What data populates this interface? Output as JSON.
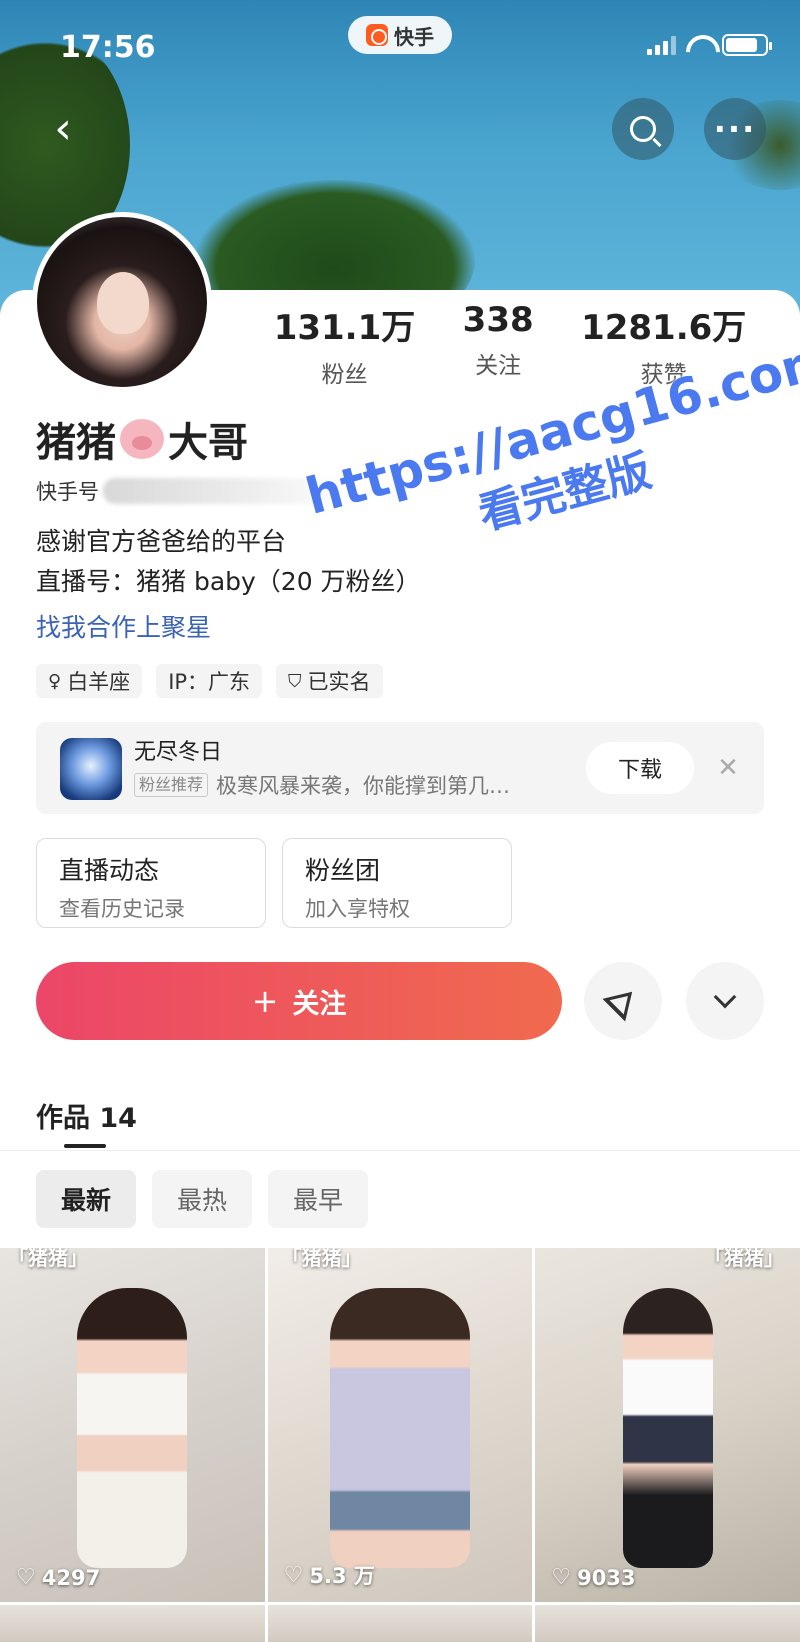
{
  "status_bar": {
    "time": "17:56",
    "app_name": "快手"
  },
  "profile": {
    "name_prefix": "猪猪",
    "name_suffix": "大哥",
    "kuaishou_id_label": "快手号",
    "bio_line1": "感谢官方爸爸给的平台",
    "bio_line2": "直播号：猪猪 baby（20 万粉丝）",
    "cooperation_link": "找我合作上聚星",
    "stats": [
      {
        "value": "131.1万",
        "label": "粉丝"
      },
      {
        "value": "338",
        "label": "关注"
      },
      {
        "value": "1281.6万",
        "label": "获赞"
      }
    ],
    "tags": [
      {
        "icon": "female-icon",
        "label": "白羊座"
      },
      {
        "icon": "",
        "label": "IP：广东"
      },
      {
        "icon": "verified-shield-icon",
        "label": "已实名"
      }
    ]
  },
  "ad": {
    "title": "无尽冬日",
    "badge": "粉丝推荐",
    "description": "极寒风暴来袭，你能撑到第几…",
    "download_label": "下载"
  },
  "cards": [
    {
      "title": "直播动态",
      "subtitle": "查看历史记录"
    },
    {
      "title": "粉丝团",
      "subtitle": "加入享特权"
    }
  ],
  "actions": {
    "follow_label": "关注",
    "follow_icon": "+"
  },
  "works": {
    "tab_label": "作品 14",
    "sort_options": [
      "最新",
      "最热",
      "最早"
    ],
    "active_sort": "最新",
    "items": [
      {
        "caption": "「猪猪」",
        "likes": "4297"
      },
      {
        "caption": "「猪猪」",
        "likes": "5.3 万"
      },
      {
        "caption": "「猪猪」",
        "likes": "9033"
      }
    ]
  },
  "watermark": {
    "url": "https://aacg16.com",
    "subtitle": "看完整版"
  },
  "colors": {
    "follow_gradient_start": "#ec4668",
    "follow_gradient_end": "#f06a4e",
    "link": "#3b63b4",
    "watermark": "#4a79f0"
  }
}
